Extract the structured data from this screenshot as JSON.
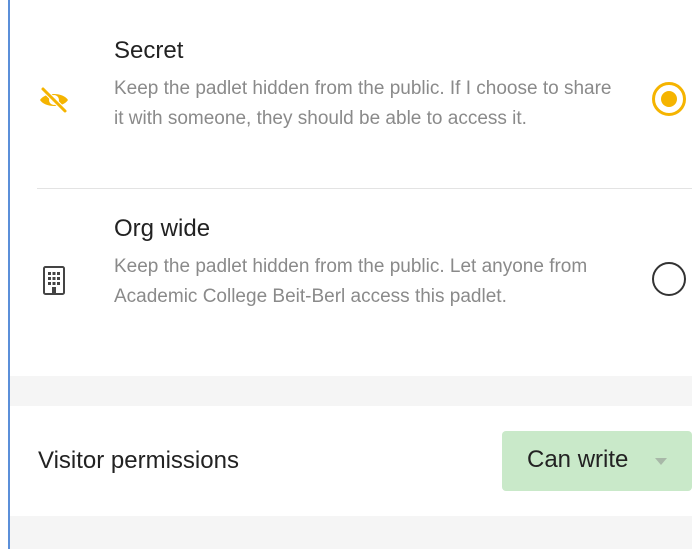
{
  "privacy_options": [
    {
      "title": "Secret",
      "description": "Keep the padlet hidden from the public. If I choose to share it with someone, they should be able to access it.",
      "icon": "eye-slash-icon",
      "selected": true
    },
    {
      "title": "Org wide",
      "description": "Keep the padlet hidden from the public. Let anyone from Academic College Beit-Berl access this padlet.",
      "icon": "building-icon",
      "selected": false
    }
  ],
  "visitor_permissions": {
    "label": "Visitor permissions",
    "value": "Can write"
  },
  "colors": {
    "accent": "#f5b400",
    "dropdown_bg": "#c9e9c9",
    "description_text": "#8a8a8a"
  }
}
